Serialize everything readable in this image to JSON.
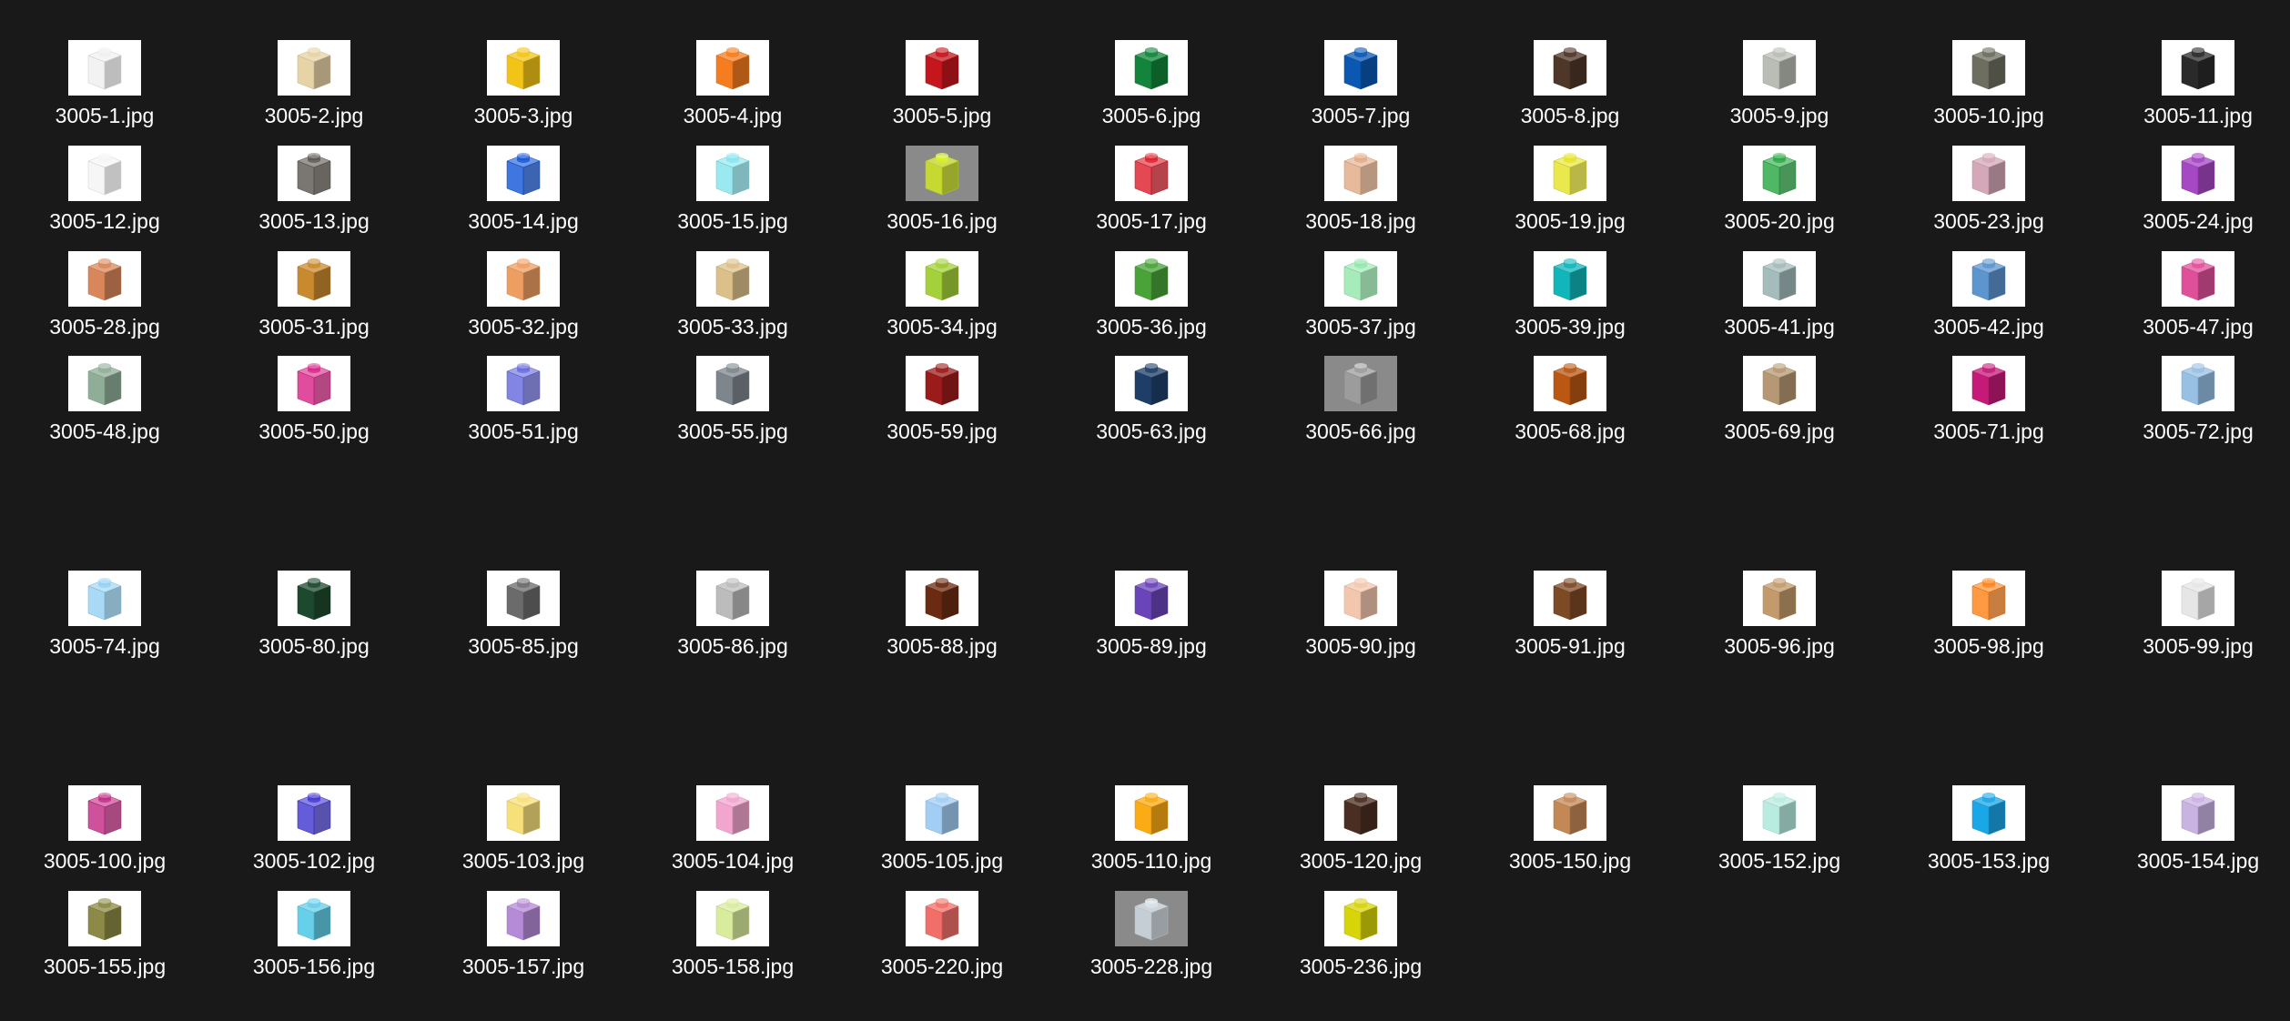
{
  "window": {
    "view": "large-icons",
    "background": "#191919"
  },
  "files": [
    [
      {
        "name": "3005-1.jpg",
        "color": "#eeeeee",
        "trans": true
      },
      {
        "name": "3005-2.jpg",
        "color": "#e6d3a6"
      },
      {
        "name": "3005-3.jpg",
        "color": "#f2c418"
      },
      {
        "name": "3005-4.jpg",
        "color": "#f57c1f"
      },
      {
        "name": "3005-5.jpg",
        "color": "#c4161c"
      },
      {
        "name": "3005-6.jpg",
        "color": "#12843b"
      },
      {
        "name": "3005-7.jpg",
        "color": "#0b58b3"
      },
      {
        "name": "3005-8.jpg",
        "color": "#4e3628"
      },
      {
        "name": "3005-9.jpg",
        "color": "#b9bdb5"
      },
      {
        "name": "3005-10.jpg",
        "color": "#6d6e60"
      },
      {
        "name": "3005-11.jpg",
        "color": "#2a2a2a"
      }
    ],
    [
      {
        "name": "3005-12.jpg",
        "color": "#f4f4f4",
        "trans": true
      },
      {
        "name": "3005-13.jpg",
        "color": "#55504a",
        "trans": true
      },
      {
        "name": "3005-14.jpg",
        "color": "#0a4fd6",
        "trans": true
      },
      {
        "name": "3005-15.jpg",
        "color": "#7fe3ec",
        "trans": true
      },
      {
        "name": "3005-16.jpg",
        "color": "#d7f019",
        "trans": true,
        "dark": true
      },
      {
        "name": "3005-17.jpg",
        "color": "#dd1421",
        "trans": true
      },
      {
        "name": "3005-18.jpg",
        "color": "#e2a780",
        "trans": true
      },
      {
        "name": "3005-19.jpg",
        "color": "#e4e21a",
        "trans": true
      },
      {
        "name": "3005-20.jpg",
        "color": "#1fa43a",
        "trans": true
      },
      {
        "name": "3005-23.jpg",
        "color": "#d4a8b8"
      },
      {
        "name": "3005-24.jpg",
        "color": "#a647c4"
      }
    ],
    [
      {
        "name": "3005-28.jpg",
        "color": "#d9875a"
      },
      {
        "name": "3005-31.jpg",
        "color": "#c98a2f"
      },
      {
        "name": "3005-32.jpg",
        "color": "#ef9e62"
      },
      {
        "name": "3005-33.jpg",
        "color": "#dcc08a"
      },
      {
        "name": "3005-34.jpg",
        "color": "#a4d13a"
      },
      {
        "name": "3005-36.jpg",
        "color": "#4aa339"
      },
      {
        "name": "3005-37.jpg",
        "color": "#8ee6a8",
        "trans": true
      },
      {
        "name": "3005-39.jpg",
        "color": "#12b5b9"
      },
      {
        "name": "3005-41.jpg",
        "color": "#a4bcbb"
      },
      {
        "name": "3005-42.jpg",
        "color": "#5d95cf"
      },
      {
        "name": "3005-47.jpg",
        "color": "#e0509a"
      }
    ],
    [
      {
        "name": "3005-48.jpg",
        "color": "#8fae98"
      },
      {
        "name": "3005-50.jpg",
        "color": "#d81b82",
        "trans": true
      },
      {
        "name": "3005-51.jpg",
        "color": "#6063dc",
        "trans": true
      },
      {
        "name": "3005-55.jpg",
        "color": "#7d868d"
      },
      {
        "name": "3005-59.jpg",
        "color": "#9b1b1b"
      },
      {
        "name": "3005-63.jpg",
        "color": "#1e3e68"
      },
      {
        "name": "3005-66.jpg",
        "color": "#9c9c9c",
        "dark": true
      },
      {
        "name": "3005-68.jpg",
        "color": "#b95713"
      },
      {
        "name": "3005-69.jpg",
        "color": "#b69974"
      },
      {
        "name": "3005-71.jpg",
        "color": "#c51a78"
      },
      {
        "name": "3005-72.jpg",
        "color": "#98c0e4"
      }
    ],
    [
      {
        "name": "3005-74.jpg",
        "color": "#8fd0f2",
        "trans": true
      },
      {
        "name": "3005-80.jpg",
        "color": "#1d4a2e"
      },
      {
        "name": "3005-85.jpg",
        "color": "#6b6b6b"
      },
      {
        "name": "3005-86.jpg",
        "color": "#bcbcbc"
      },
      {
        "name": "3005-88.jpg",
        "color": "#6b2b12"
      },
      {
        "name": "3005-89.jpg",
        "color": "#6a44b9"
      },
      {
        "name": "3005-90.jpg",
        "color": "#f3c7ae"
      },
      {
        "name": "3005-91.jpg",
        "color": "#7d4a26"
      },
      {
        "name": "3005-96.jpg",
        "color": "#c39a6b"
      },
      {
        "name": "3005-98.jpg",
        "color": "#ff7d0e",
        "trans": true
      },
      {
        "name": "3005-99.jpg",
        "color": "#e6e6e6"
      }
    ],
    [
      {
        "name": "3005-100.jpg",
        "color": "#c0207f",
        "trans": true
      },
      {
        "name": "3005-102.jpg",
        "color": "#3a2ed0",
        "trans": true
      },
      {
        "name": "3005-103.jpg",
        "color": "#f7df7a"
      },
      {
        "name": "3005-104.jpg",
        "color": "#f2a6cf"
      },
      {
        "name": "3005-105.jpg",
        "color": "#a2cdf4"
      },
      {
        "name": "3005-110.jpg",
        "color": "#fbab13"
      },
      {
        "name": "3005-120.jpg",
        "color": "#4a2e22"
      },
      {
        "name": "3005-150.jpg",
        "color": "#c48857"
      },
      {
        "name": "3005-152.jpg",
        "color": "#b9ece0"
      },
      {
        "name": "3005-153.jpg",
        "color": "#1aa7e8"
      },
      {
        "name": "3005-154.jpg",
        "color": "#c9b3e3"
      }
    ],
    [
      {
        "name": "3005-155.jpg",
        "color": "#8c8a46"
      },
      {
        "name": "3005-156.jpg",
        "color": "#66cfea"
      },
      {
        "name": "3005-157.jpg",
        "color": "#b58ad6"
      },
      {
        "name": "3005-158.jpg",
        "color": "#d9ec9d"
      },
      {
        "name": "3005-220.jpg",
        "color": "#f16f68"
      },
      {
        "name": "3005-228.jpg",
        "color": "#d7e2ea",
        "trans": true,
        "dark": true
      },
      {
        "name": "3005-236.jpg",
        "color": "#d8d40a"
      }
    ]
  ]
}
